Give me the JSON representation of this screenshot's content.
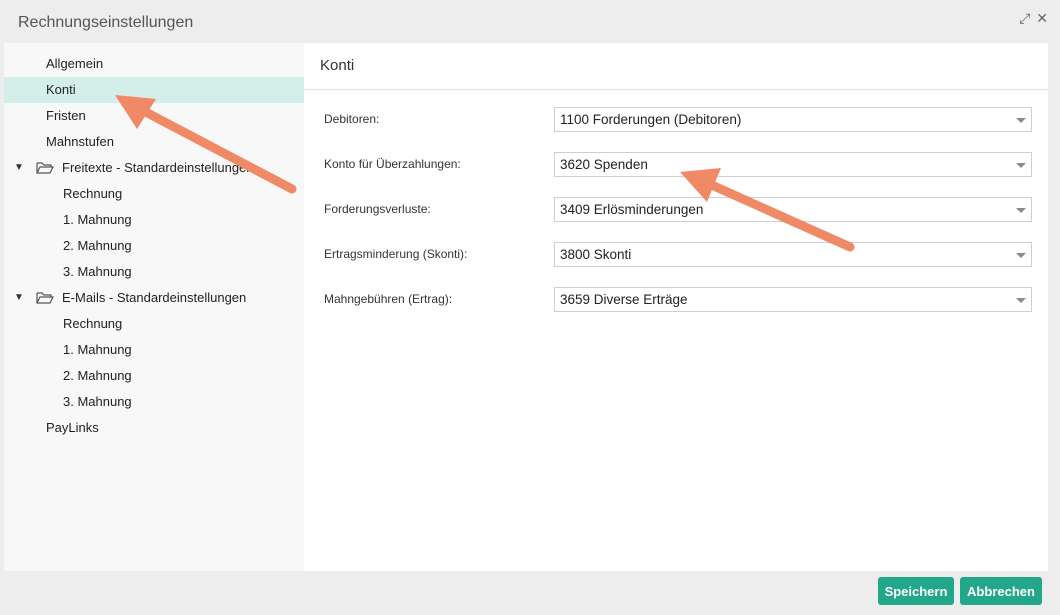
{
  "window": {
    "title": "Rechnungseinstellungen"
  },
  "sidebar": {
    "items": [
      {
        "label": "Allgemein"
      },
      {
        "label": "Konti"
      },
      {
        "label": "Fristen"
      },
      {
        "label": "Mahnstufen"
      },
      {
        "label": "Freitexte - Standardeinstellungen"
      },
      {
        "label": "Rechnung"
      },
      {
        "label": "1. Mahnung"
      },
      {
        "label": "2. Mahnung"
      },
      {
        "label": "3. Mahnung"
      },
      {
        "label": "E-Mails - Standardeinstellungen"
      },
      {
        "label": "Rechnung"
      },
      {
        "label": "1. Mahnung"
      },
      {
        "label": "2. Mahnung"
      },
      {
        "label": "3. Mahnung"
      },
      {
        "label": "PayLinks"
      }
    ]
  },
  "main": {
    "title": "Konti",
    "fields": [
      {
        "label": "Debitoren:",
        "value": "1100 Forderungen (Debitoren)"
      },
      {
        "label": "Konto für Überzahlungen:",
        "value": "3620 Spenden"
      },
      {
        "label": "Forderungsverluste:",
        "value": "3409 Erlösminderungen"
      },
      {
        "label": "Ertragsminderung (Skonti):",
        "value": "3800 Skonti"
      },
      {
        "label": "Mahngebühren (Ertrag):",
        "value": "3659 Diverse Erträge"
      }
    ]
  },
  "buttons": {
    "save": "Speichern",
    "cancel": "Abbrechen"
  },
  "colors": {
    "accent": "#23a78a",
    "selected": "#d4efea",
    "annotation": "#f08a66"
  }
}
